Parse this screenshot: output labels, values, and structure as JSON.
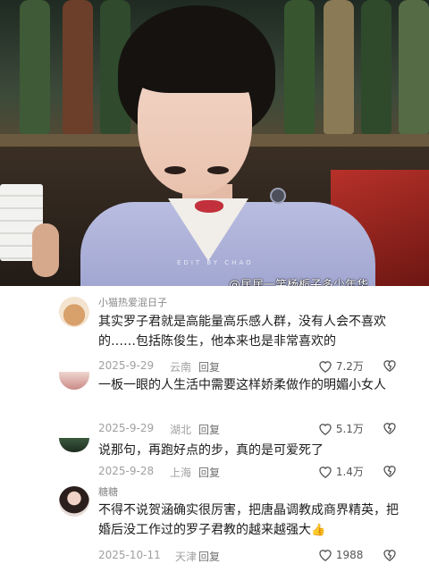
{
  "video": {
    "overlay_mark": "EDIT BY CHAO",
    "watermark": "@居居一笑杨栀子多少年华"
  },
  "comments": [
    {
      "username": "小猫热爱混日子",
      "text": "其实罗子君就是高能量高乐感人群，没有人会不喜欢的……包括陈俊生，他本来也是非常喜欢的",
      "date": "2025-9-29",
      "location": "云南",
      "reply_label": "回复",
      "likes": "7.2万"
    },
    {
      "username": "",
      "text": "一板一眼的人生活中需要这样娇柔做作的明媚小女人",
      "date": "2025-9-29",
      "location": "湖北",
      "reply_label": "回复",
      "likes": "5.1万"
    },
    {
      "username": "",
      "text": "说那句，再跑好点的步，真的是可爱死了",
      "date": "2025-9-28",
      "location": "上海",
      "reply_label": "回复",
      "likes": "1.4万"
    },
    {
      "username": "糖糖",
      "text": "不得不说贺涵确实很厉害，把唐晶调教成商界精英，把婚后没工作过的罗子君教的越来越强大",
      "emoji": "👍",
      "date": "2025-10-11",
      "location": "天津",
      "reply_label": "回复",
      "likes": "1988"
    }
  ],
  "colors": {
    "text": "#1c1c1c",
    "meta": "#a0a0a0",
    "accent_emoji": "#f5b400"
  }
}
